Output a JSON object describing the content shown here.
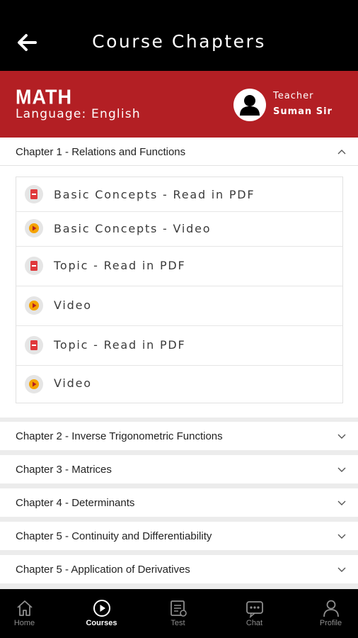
{
  "app_bar": {
    "title": "Course Chapters"
  },
  "course": {
    "subject": "MATH",
    "language": "Language: English",
    "teacher_label": "Teacher",
    "teacher_name": "Suman Sir"
  },
  "chapters": [
    {
      "title": "Chapter 1 - Relations and Functions",
      "expanded": true,
      "lessons": [
        {
          "type": "pdf",
          "label": "Basic Concepts - Read in PDF"
        },
        {
          "type": "video",
          "label": "Basic Concepts - Video"
        },
        {
          "type": "pdf",
          "label": "Topic - Read in PDF"
        },
        {
          "type": "video",
          "label": "Video"
        },
        {
          "type": "pdf",
          "label": "Topic - Read in PDF"
        },
        {
          "type": "video",
          "label": "Video"
        }
      ]
    },
    {
      "title": "Chapter 2 - Inverse Trigonometric Functions",
      "expanded": false
    },
    {
      "title": "Chapter 3 - Matrices",
      "expanded": false
    },
    {
      "title": "Chapter 4 - Determinants",
      "expanded": false
    },
    {
      "title": "Chapter 5 - Continuity and Differentiability",
      "expanded": false
    },
    {
      "title": "Chapter 5 - Application of Derivatives",
      "expanded": false
    }
  ],
  "nav": {
    "items": [
      {
        "label": "Home",
        "icon": "home-icon"
      },
      {
        "label": "Courses",
        "icon": "play-circle-icon",
        "active": true
      },
      {
        "label": "Test",
        "icon": "test-icon"
      },
      {
        "label": "Chat",
        "icon": "chat-icon"
      },
      {
        "label": "Profile",
        "icon": "profile-icon"
      }
    ]
  },
  "colors": {
    "app_bar": "#000000",
    "banner": "#b31f24",
    "pdf_icon": "#e0393c",
    "video_icon": "#f5a300"
  }
}
